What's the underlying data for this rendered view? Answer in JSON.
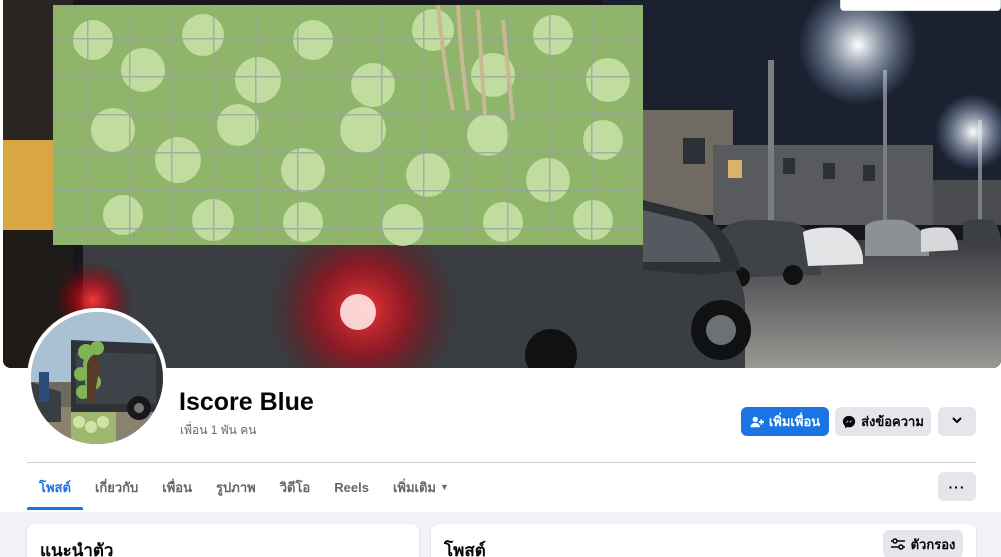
{
  "profile": {
    "name": "Iscore Blue",
    "friends": "เพื่อน 1 พัน คน",
    "cover_alt": "pickup-truck-loaded-with-cabbages-at-night",
    "avatar_alt": "truck-with-cabbages-photo"
  },
  "actions": {
    "add_friend": "เพิ่มเพื่อน",
    "message": "ส่งข้อความ",
    "more_icon": "chevron-down-icon"
  },
  "tabs": [
    {
      "label": "โพสต์",
      "active": true
    },
    {
      "label": "เกี่ยวกับ",
      "active": false
    },
    {
      "label": "เพื่อน",
      "active": false
    },
    {
      "label": "รูปภาพ",
      "active": false
    },
    {
      "label": "วิดีโอ",
      "active": false
    },
    {
      "label": "Reels",
      "active": false
    },
    {
      "label": "เพิ่มเติม",
      "active": false
    }
  ],
  "tabs_more": "···",
  "intro": {
    "title": "แนะนำตัว"
  },
  "posts": {
    "title": "โพสต์",
    "filter": "ตัวกรอง"
  },
  "colors": {
    "accent": "#1b74e4",
    "secondary_button": "#e4e6eb",
    "page_bg": "#f0f2f5",
    "muted_text": "#65676b"
  }
}
